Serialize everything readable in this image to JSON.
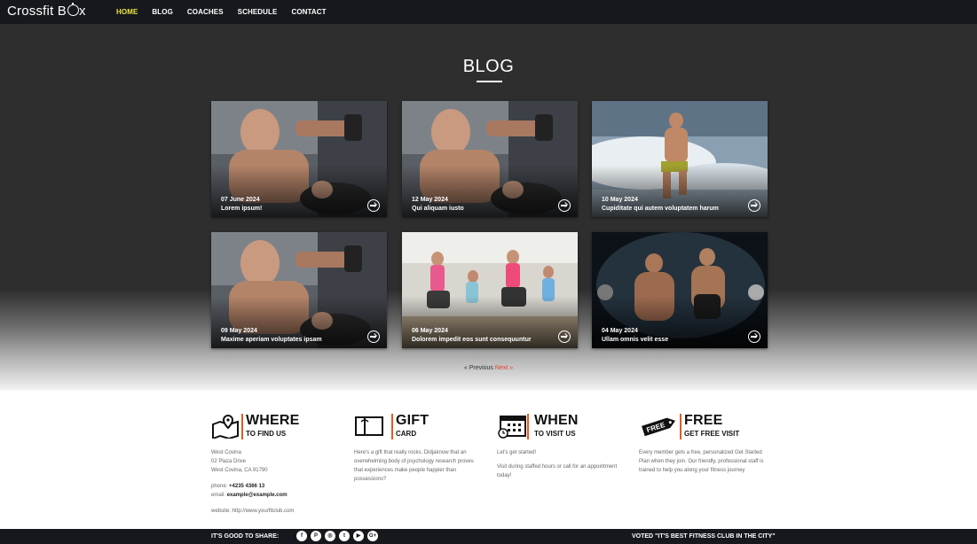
{
  "header": {
    "logo_text": "Crossfit B",
    "logo_text_tail": "x",
    "nav": [
      {
        "label": "HOME",
        "active": true
      },
      {
        "label": "BLOG",
        "active": false
      },
      {
        "label": "COACHES",
        "active": false
      },
      {
        "label": "SCHEDULE",
        "active": false
      },
      {
        "label": "CONTACT",
        "active": false
      }
    ]
  },
  "blog": {
    "title": "BLOG",
    "posts": [
      {
        "date": "07 June 2024",
        "title": "Lorem ipsum!"
      },
      {
        "date": "12 May 2024",
        "title": "Qui aliquam iusto"
      },
      {
        "date": "10 May 2024",
        "title": "Cupiditate qui autem voluptatem harum"
      },
      {
        "date": "09 May 2024",
        "title": "Maxime aperiam voluptates ipsam"
      },
      {
        "date": "06 May 2024",
        "title": "Dolorem impedit eos sunt consequuntur"
      },
      {
        "date": "04 May 2024",
        "title": "Ullam omnis velit esse"
      }
    ],
    "pagination": {
      "previous": "« Previous",
      "next": "Next »"
    }
  },
  "info": {
    "where": {
      "heading": "WHERE",
      "subheading": "TO FIND US",
      "lines": [
        "West Covina",
        "02 Plaza Drive",
        "West Covina, CA 91790"
      ],
      "phone_label": "phone:",
      "phone": "+4235 4366 13",
      "email_label": "email:",
      "email": "example@example.com",
      "website_label": "website:",
      "website": "http://www.yourfitclub.com"
    },
    "gift": {
      "heading": "GIFT",
      "subheading": "CARD",
      "text": "Here's a gift that really rocks. Didjaknow that an overwhelming body of psychology research proves that experiences make people happier than possessions?"
    },
    "when": {
      "heading": "WHEN",
      "subheading": "TO VISIT US",
      "text1": "Let's get started!",
      "text2": "Visit during staffed hours or call for an appointment today!"
    },
    "free": {
      "heading": "FREE",
      "subheading": "GET FREE VISIT",
      "tag": "FREE",
      "text": "Every member gets a free, personalized Get Started Plan when they join. Our friendly, professional staff is trained to help you along your fitness journey"
    }
  },
  "footer": {
    "share_label": "IT'S GOOD TO SHARE:",
    "socials": [
      "facebook-icon",
      "pinterest-icon",
      "instagram-icon",
      "twitter-icon",
      "youtube-icon",
      "google-plus-icon"
    ],
    "social_glyphs": [
      "f",
      "P",
      "◎",
      "t",
      "▶",
      "G+"
    ],
    "voted": "VOTED \"IT'S BEST FITNESS CLUB IN THE CITY\""
  },
  "colors": {
    "accent": "#e35b1f",
    "nav_active": "#f0e442",
    "next_link": "#e53a2a",
    "dark": "#16181d"
  }
}
